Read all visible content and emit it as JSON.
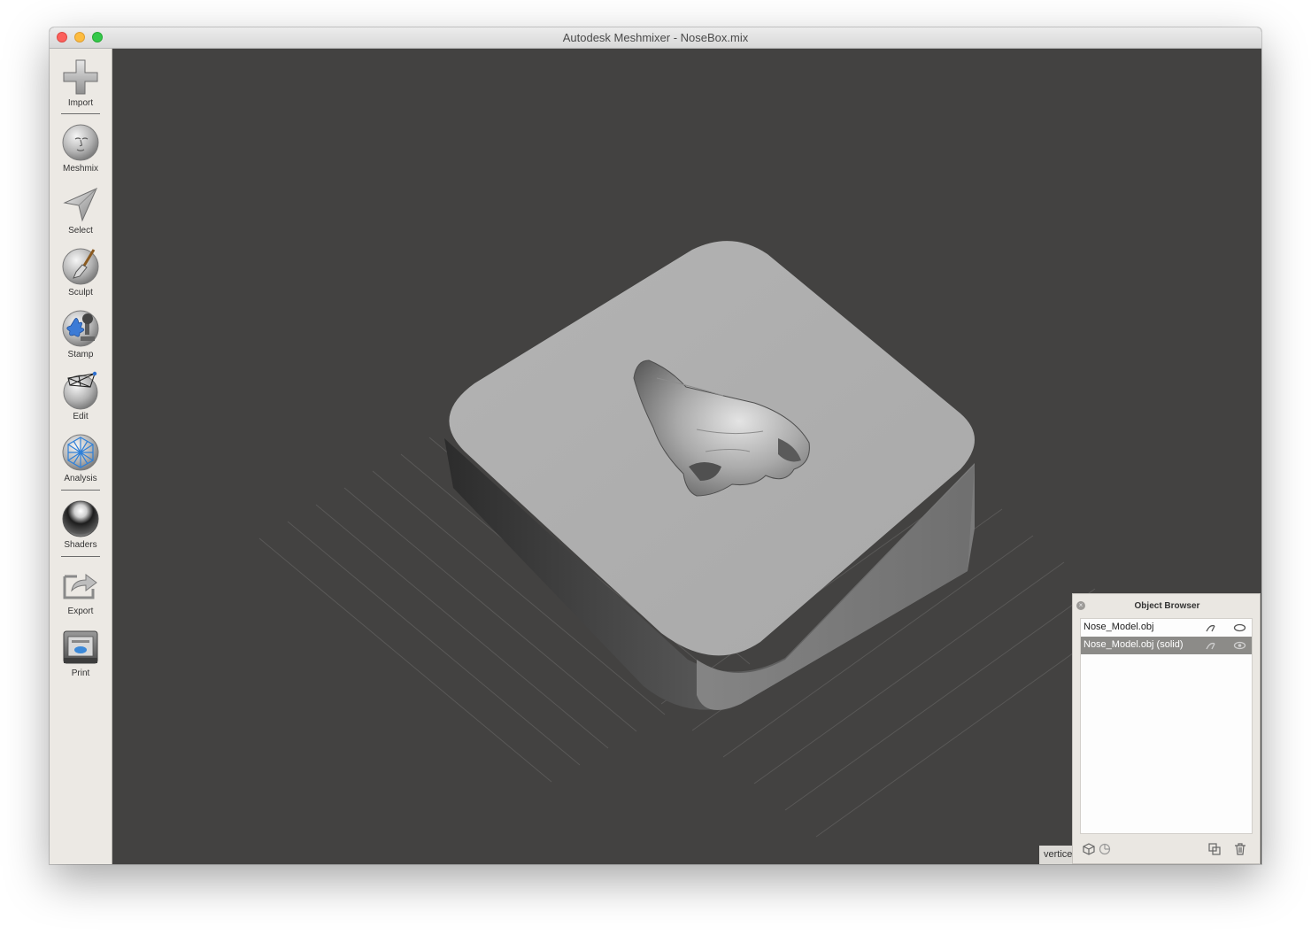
{
  "window": {
    "title": "Autodesk Meshmixer - NoseBox.mix"
  },
  "toolbar": {
    "import_label": "Import",
    "meshmix_label": "Meshmix",
    "select_label": "Select",
    "sculpt_label": "Sculpt",
    "stamp_label": "Stamp",
    "edit_label": "Edit",
    "analysis_label": "Analysis",
    "shaders_label": "Shaders",
    "export_label": "Export",
    "print_label": "Print"
  },
  "status": {
    "text": "vertice"
  },
  "object_browser": {
    "title": "Object Browser",
    "items": [
      {
        "name": "Nose_Model.obj",
        "selected": false
      },
      {
        "name": "Nose_Model.obj (solid)",
        "selected": true
      }
    ]
  },
  "colors": {
    "viewport_bg": "#434241",
    "toolbar_bg": "#ece9e4",
    "selection": "#8c8b88"
  }
}
